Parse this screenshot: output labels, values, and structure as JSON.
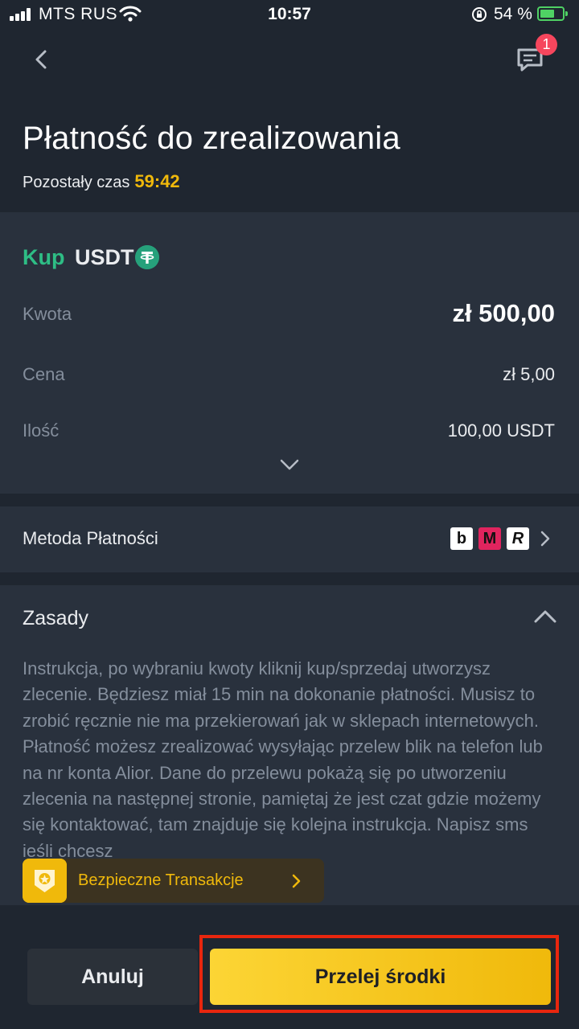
{
  "status_bar": {
    "carrier": "MTS RUS",
    "time": "10:57",
    "battery": "54 %"
  },
  "header": {
    "chat_badge": "1",
    "title": "Płatność do zrealizowania",
    "timer_label": "Pozostały czas",
    "timer_value": "59:42"
  },
  "order": {
    "side": "Kup",
    "asset": "USDT",
    "rows": [
      {
        "label": "Kwota",
        "value": "zł 500,00"
      },
      {
        "label": "Cena",
        "value": "zł 5,00"
      },
      {
        "label": "Ilość",
        "value": "100,00 USDT"
      }
    ]
  },
  "payment": {
    "label": "Metoda Płatności",
    "methods": [
      {
        "icon": "blik-logo",
        "glyph": "b"
      },
      {
        "icon": "mbank-logo",
        "glyph": "M"
      },
      {
        "icon": "revolut-logo",
        "glyph": "R"
      }
    ]
  },
  "rules": {
    "title": "Zasady",
    "text": "Instrukcja, po wybraniu kwoty kliknij kup/sprzedaj utworzysz zlecenie. Będziesz miał 15 min na dokonanie płatności. Musisz to zrobić ręcznie nie ma przekierowań jak w sklepach internetowych. Płatność możesz zrealizować wysyłając przelew blik na telefon lub na nr konta Alior. Dane do przelewu pokażą się po utworzeniu zlecenia na następnej stronie, pamiętaj że jest czat gdzie możemy się kontaktować, tam znajduje się kolejna instrukcja. Napisz sms jeśli chcesz"
  },
  "safe_banner": {
    "label": "Bezpieczne Transakcje"
  },
  "buttons": {
    "cancel": "Anuluj",
    "pay": "Przelej środki"
  },
  "colors": {
    "accent": "#f0b90b",
    "buy": "#2ebd85",
    "background": "#1f2630",
    "card": "#29313d",
    "highlight": "#e8260e"
  }
}
